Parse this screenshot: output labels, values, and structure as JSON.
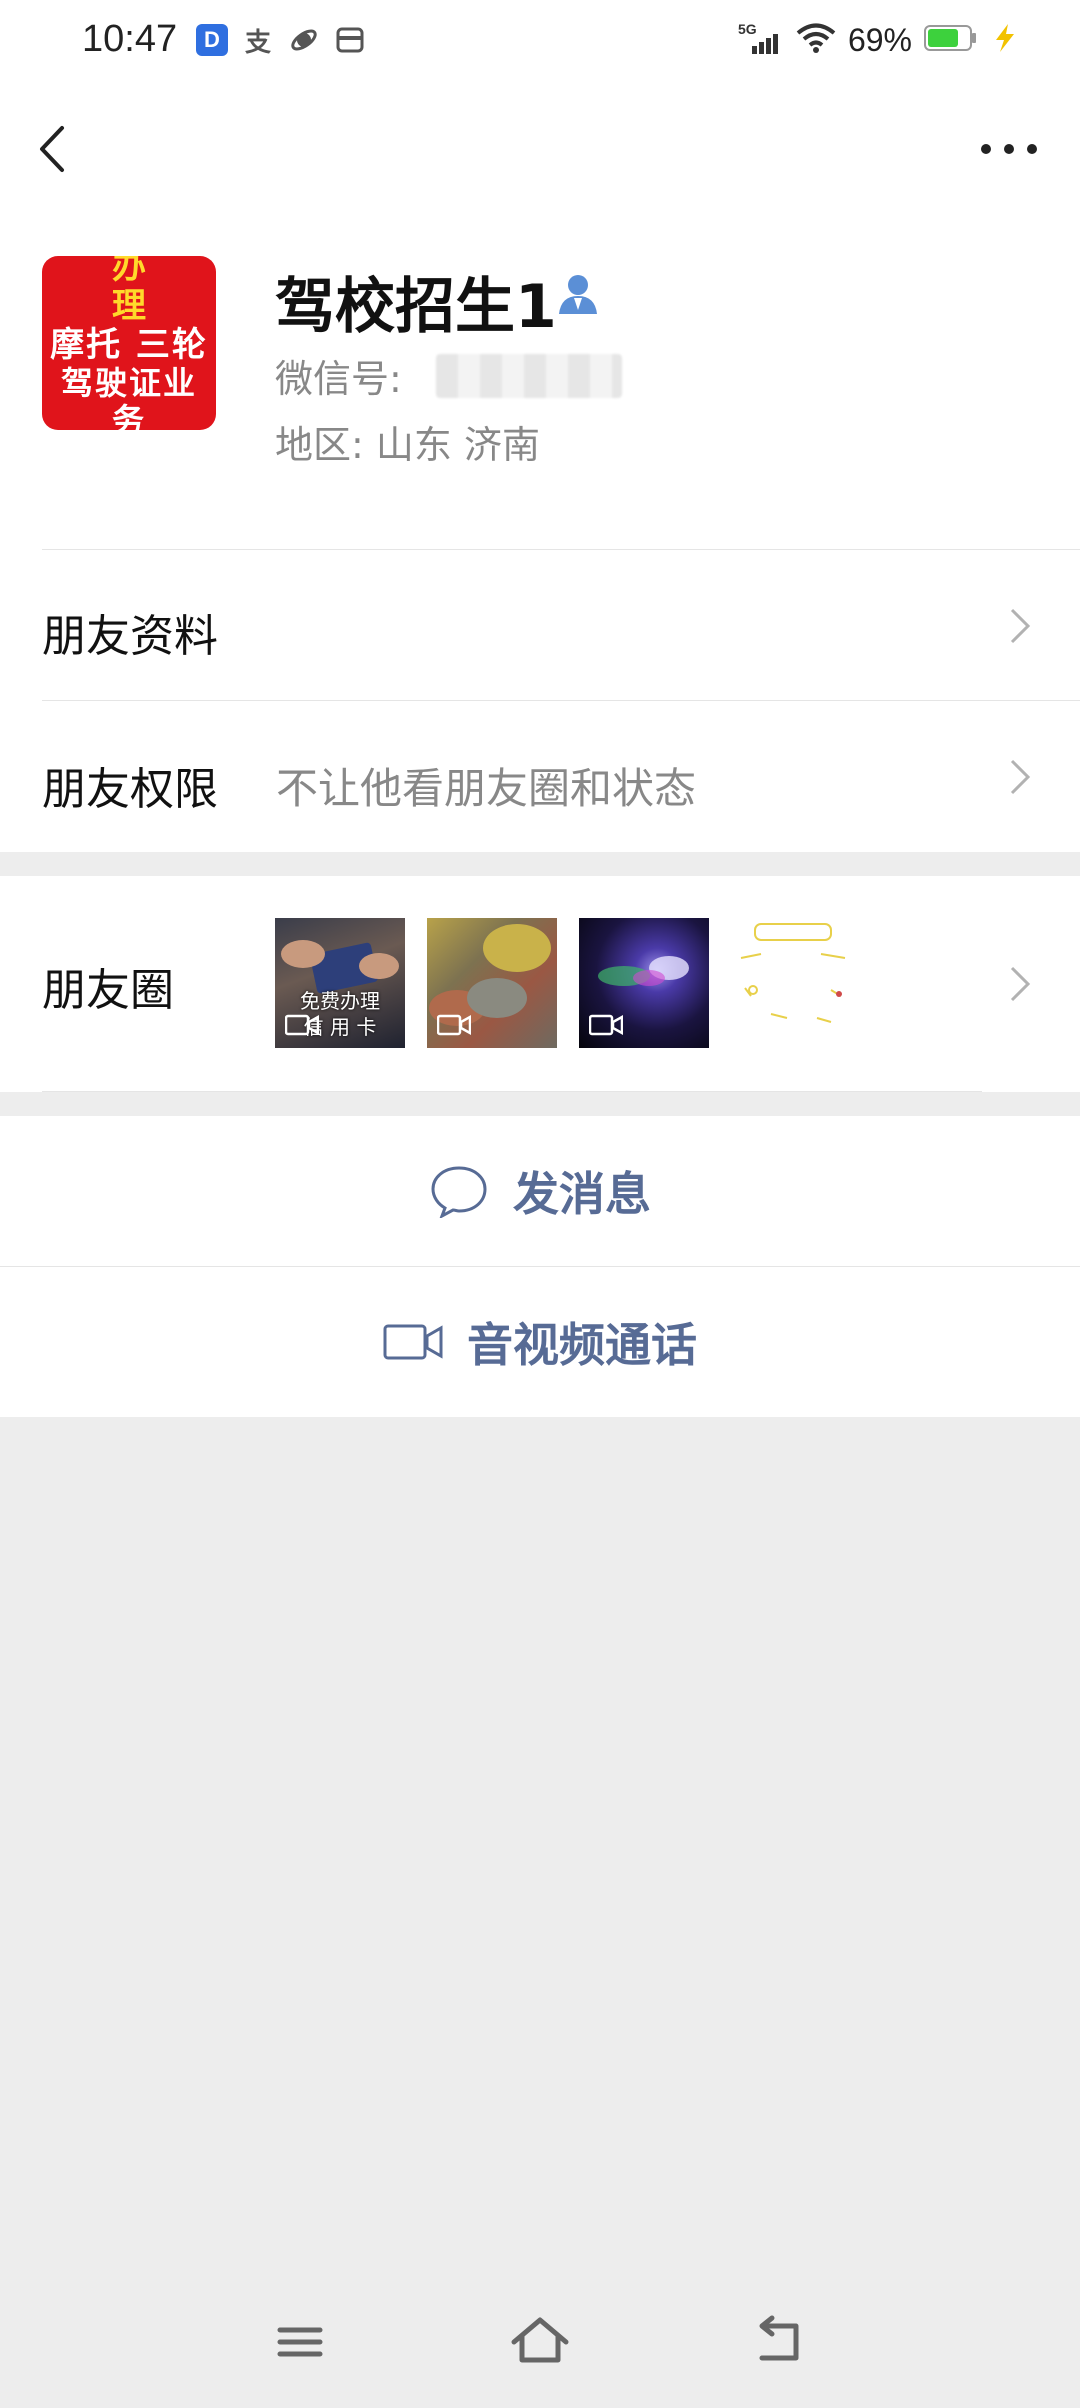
{
  "status_bar": {
    "time": "10:47",
    "battery": "69%",
    "network": "5G",
    "icons": [
      "d-app-icon",
      "alipay-icon",
      "planet-icon",
      "wallet-icon"
    ]
  },
  "header": {
    "back_icon": "chevron-left-icon",
    "more_icon": "more-horizontal-icon"
  },
  "profile": {
    "avatar_lines": [
      "办 理",
      "摩托 三轮",
      "驾驶证业务"
    ],
    "name": "驾校招生1",
    "wechat_id_label": "微信号: ",
    "region": "地区: 山东 济南",
    "badge_icon": "contact-person-icon"
  },
  "rows": {
    "friend_info": {
      "label": "朋友资料"
    },
    "friend_permission": {
      "label": "朋友权限",
      "value": "不让他看朋友圈和状态"
    },
    "moments": {
      "label": "朋友圈",
      "thumbs": [
        {
          "caption": "免费办理\n信 用 卡",
          "is_video": true
        },
        {
          "caption": "",
          "is_video": true
        },
        {
          "caption": "",
          "is_video": true
        },
        {
          "caption": "",
          "is_video": false
        }
      ]
    }
  },
  "actions": {
    "send_message": "发消息",
    "av_call": "音视频通话"
  },
  "nav": {
    "menu_icon": "menu-icon",
    "home_icon": "home-icon",
    "back_icon": "back-arrow-icon"
  },
  "colors": {
    "link_blue": "#576b95",
    "background": "#ededed",
    "avatar_red": "#e0141b"
  }
}
